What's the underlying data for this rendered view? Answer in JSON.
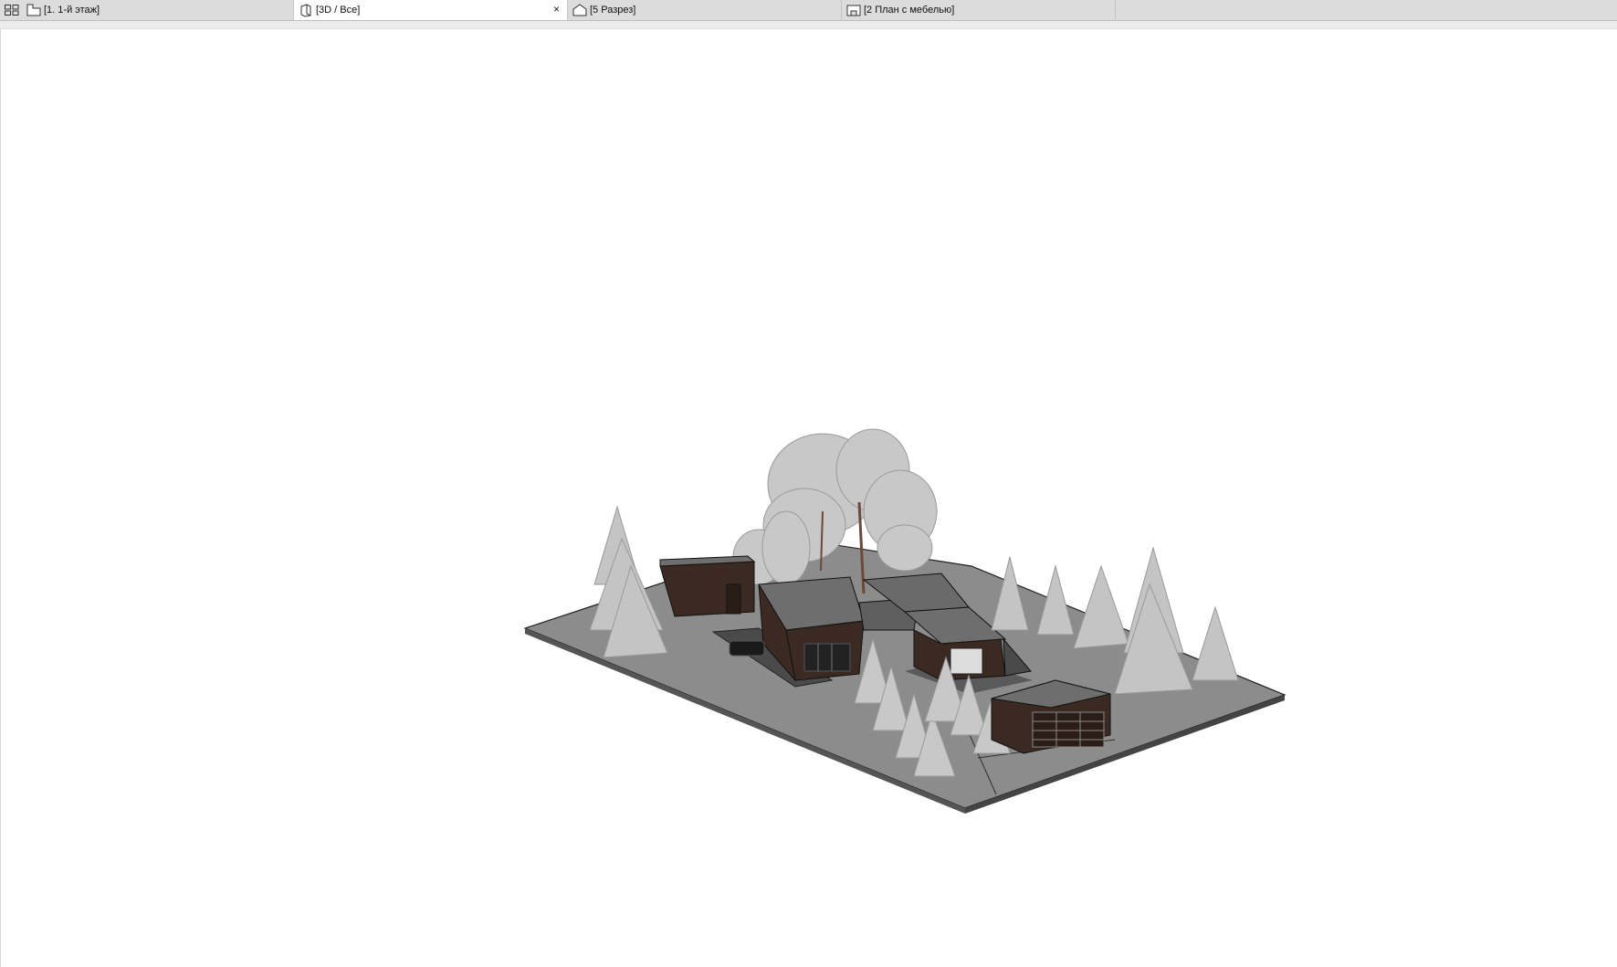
{
  "tabs": [
    {
      "label": "[1. 1-й этаж]",
      "icon": "floor-plan-icon",
      "active": false
    },
    {
      "label": "[3D / Все]",
      "icon": "3d-view-icon",
      "active": true
    },
    {
      "label": "[5 Разрез]",
      "icon": "section-icon",
      "active": false
    },
    {
      "label": "[2 План с мебелью]",
      "icon": "layout-icon",
      "active": false
    }
  ],
  "close_glyph": "×",
  "viewport": {
    "content": "3D model of house site with trees and outbuildings"
  },
  "colors": {
    "tabbar_bg": "#dcdcdc",
    "active_tab_bg": "#ffffff",
    "ground": "#8c8c8c",
    "building_wood": "#3b2a22",
    "roof": "#6e6e6e",
    "tree": "#bfbfbf"
  }
}
